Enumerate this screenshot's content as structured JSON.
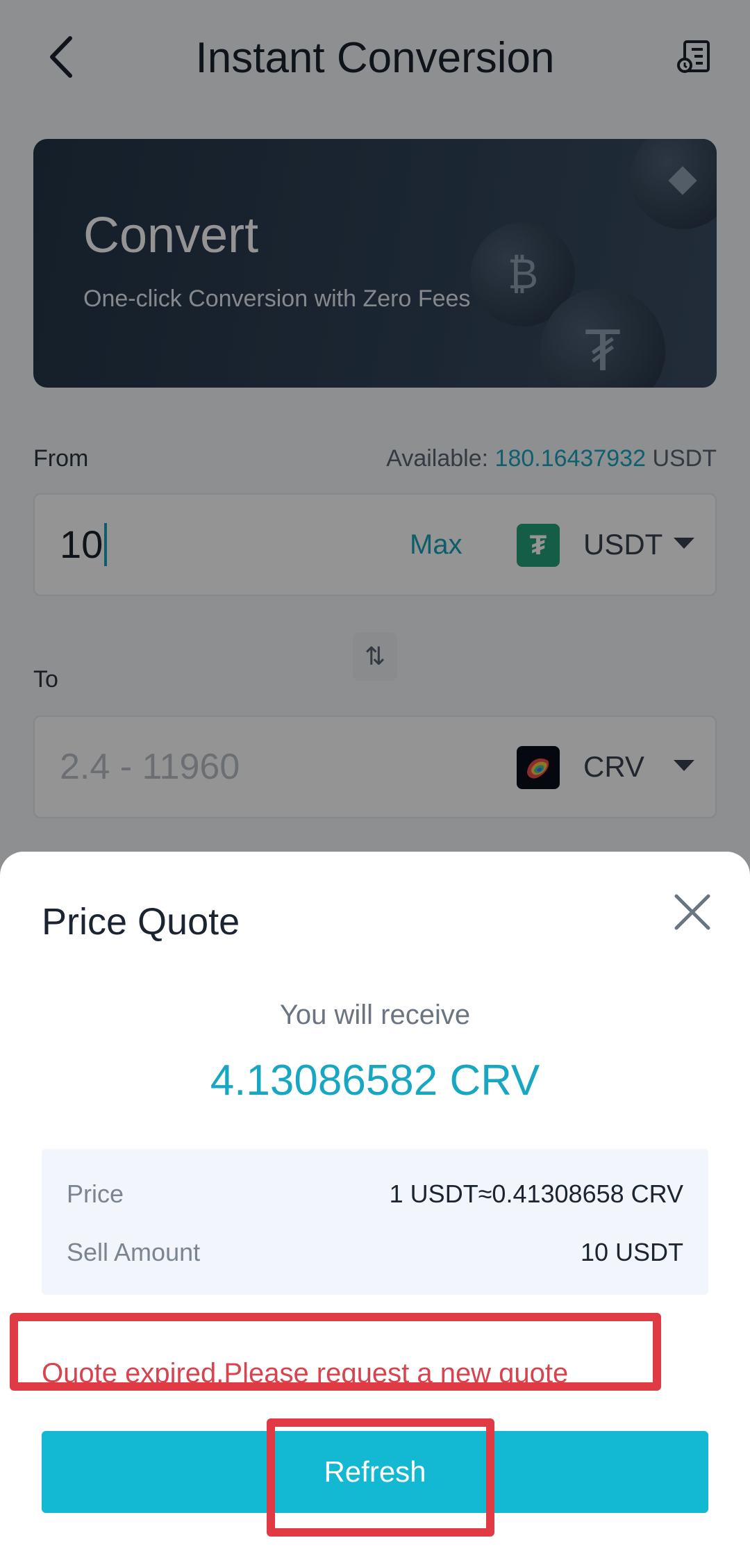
{
  "header": {
    "title": "Instant Conversion",
    "back_icon": "chevron-left-icon",
    "history_icon": "order-history-icon"
  },
  "banner": {
    "title": "Convert",
    "subtitle": "One-click Conversion with Zero Fees"
  },
  "from": {
    "label": "From",
    "available_label": "Available:",
    "available_amount": "180.16437932",
    "available_unit": "USDT",
    "amount": "10",
    "max_label": "Max",
    "token": "USDT",
    "token_icon": "tether-icon"
  },
  "to": {
    "label": "To",
    "placeholder": "2.4 - 11960",
    "token": "CRV",
    "token_icon": "curve-icon"
  },
  "quote_sheet": {
    "title": "Price Quote",
    "receive_caption": "You will receive",
    "receive_amount": "4.13086582 CRV",
    "details": [
      {
        "label": "Price",
        "value": "1 USDT≈0.41308658 CRV"
      },
      {
        "label": "Sell Amount",
        "value": "10 USDT"
      }
    ],
    "expired_message": "Quote expired.Please request a new quote",
    "refresh_label": "Refresh"
  },
  "colors": {
    "accent": "#13b8d3",
    "error": "#d8434d",
    "annotation": "#e03a45",
    "usdt": "#26a17b"
  }
}
